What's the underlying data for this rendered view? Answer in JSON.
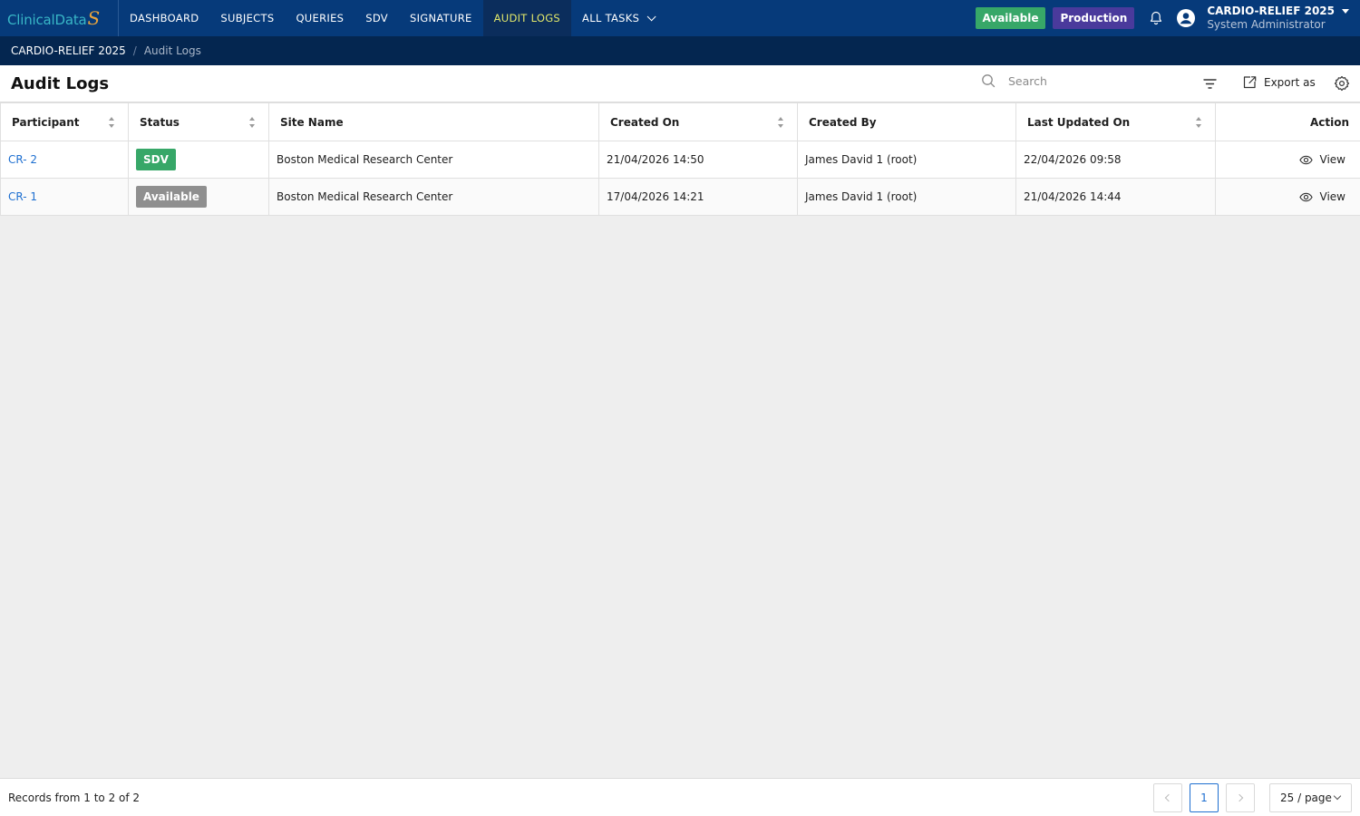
{
  "app": {
    "logo_text": "ClinicalData",
    "logo_swoosh": "S"
  },
  "nav": {
    "items": [
      {
        "label": "DASHBOARD"
      },
      {
        "label": "SUBJECTS"
      },
      {
        "label": "QUERIES"
      },
      {
        "label": "SDV"
      },
      {
        "label": "SIGNATURE"
      },
      {
        "label": "AUDIT LOGS",
        "active": true
      },
      {
        "label": "ALL TASKS"
      }
    ],
    "status_badge": "Available",
    "env_badge": "Production",
    "study_name": "CARDIO-RELIEF 2025",
    "user_role": "System Administrator"
  },
  "breadcrumb": {
    "study": "CARDIO-RELIEF 2025",
    "separator": "/",
    "current": "Audit Logs"
  },
  "page": {
    "title": "Audit Logs",
    "search_placeholder": "Search",
    "export_label": "Export as"
  },
  "table": {
    "columns": [
      "Participant",
      "Status",
      "Site Name",
      "Created On",
      "Created By",
      "Last Updated On",
      "Action"
    ],
    "rows": [
      {
        "participant": "CR- 2",
        "status": "SDV",
        "site": "Boston Medical Research Center",
        "created_on": "21/04/2026 14:50",
        "created_by": "James David 1 (root)",
        "updated_on": "22/04/2026 09:58",
        "action": "View"
      },
      {
        "participant": "CR- 1",
        "status": "Available",
        "site": "Boston Medical Research Center",
        "created_on": "17/04/2026 14:21",
        "created_by": "James David 1 (root)",
        "updated_on": "21/04/2026 14:44",
        "action": "View"
      }
    ]
  },
  "footer": {
    "records": "Records from 1 to 2 of 2",
    "current_page": "1",
    "page_size": "25 / page"
  },
  "colors": {
    "nav_bg": "#063a7a",
    "breadcrumb_bg": "#042650",
    "active_nav_text": "#e2e86a",
    "green": "#37a768",
    "purple": "#4a3a9c",
    "link": "#1e6fd0"
  }
}
